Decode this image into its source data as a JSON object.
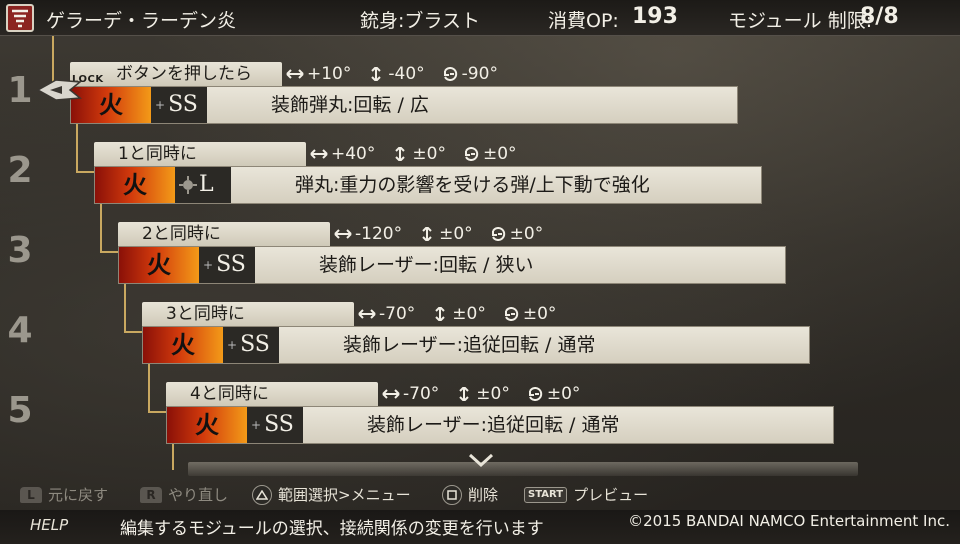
{
  "header": {
    "bullet_name": "ゲラーデ・ラーデン炎",
    "barrel_label": "銃身:ブラスト",
    "op_label": "消費OP:",
    "op_value": "193",
    "limit_label": "モジュール 制限:",
    "limit_value": "8/8"
  },
  "row_numbers": [
    "1",
    "2",
    "3",
    "4",
    "5"
  ],
  "modules": [
    {
      "lock": "LOCK",
      "trigger": "ボタンを押したら",
      "horizontal": "+10°",
      "vertical": "-40°",
      "rotation": "-90°",
      "element": "火",
      "size": "SS",
      "size_icon": "plus",
      "description": "装飾弾丸:回転 / 広"
    },
    {
      "trigger": "1と同時に",
      "horizontal": "+40°",
      "vertical": "±0°",
      "rotation": "±0°",
      "element": "火",
      "size": "L",
      "size_icon": "crosshair",
      "description": "弾丸:重力の影響を受ける弾/上下動で強化"
    },
    {
      "trigger": "2と同時に",
      "horizontal": "-120°",
      "vertical": "±0°",
      "rotation": "±0°",
      "element": "火",
      "size": "SS",
      "size_icon": "plus",
      "description": "装飾レーザー:回転 / 狭い"
    },
    {
      "trigger": "3と同時に",
      "horizontal": "-70°",
      "vertical": "±0°",
      "rotation": "±0°",
      "element": "火",
      "size": "SS",
      "size_icon": "plus",
      "description": "装飾レーザー:追従回転 / 通常"
    },
    {
      "trigger": "4と同時に",
      "horizontal": "-70°",
      "vertical": "±0°",
      "rotation": "±0°",
      "element": "火",
      "size": "SS",
      "size_icon": "plus",
      "description": "装飾レーザー:追従回転 / 通常"
    }
  ],
  "controls": {
    "undo_button": "L",
    "undo": "元に戻す",
    "redo_button": "R",
    "redo": "やり直し",
    "range_select_menu": "範囲選択>メニュー",
    "delete": "削除",
    "start_button": "START",
    "preview": "プレビュー"
  },
  "help": {
    "label": "HELP",
    "text": "編集するモジュールの選択、接続関係の変更を行います",
    "copyright": "©2015 BANDAI NAMCO Entertainment Inc."
  },
  "colors": {
    "fire_start": "#8a1008",
    "fire_end": "#f39a18",
    "tree_line": "#c9a860",
    "panel": "#e9e5d9"
  }
}
